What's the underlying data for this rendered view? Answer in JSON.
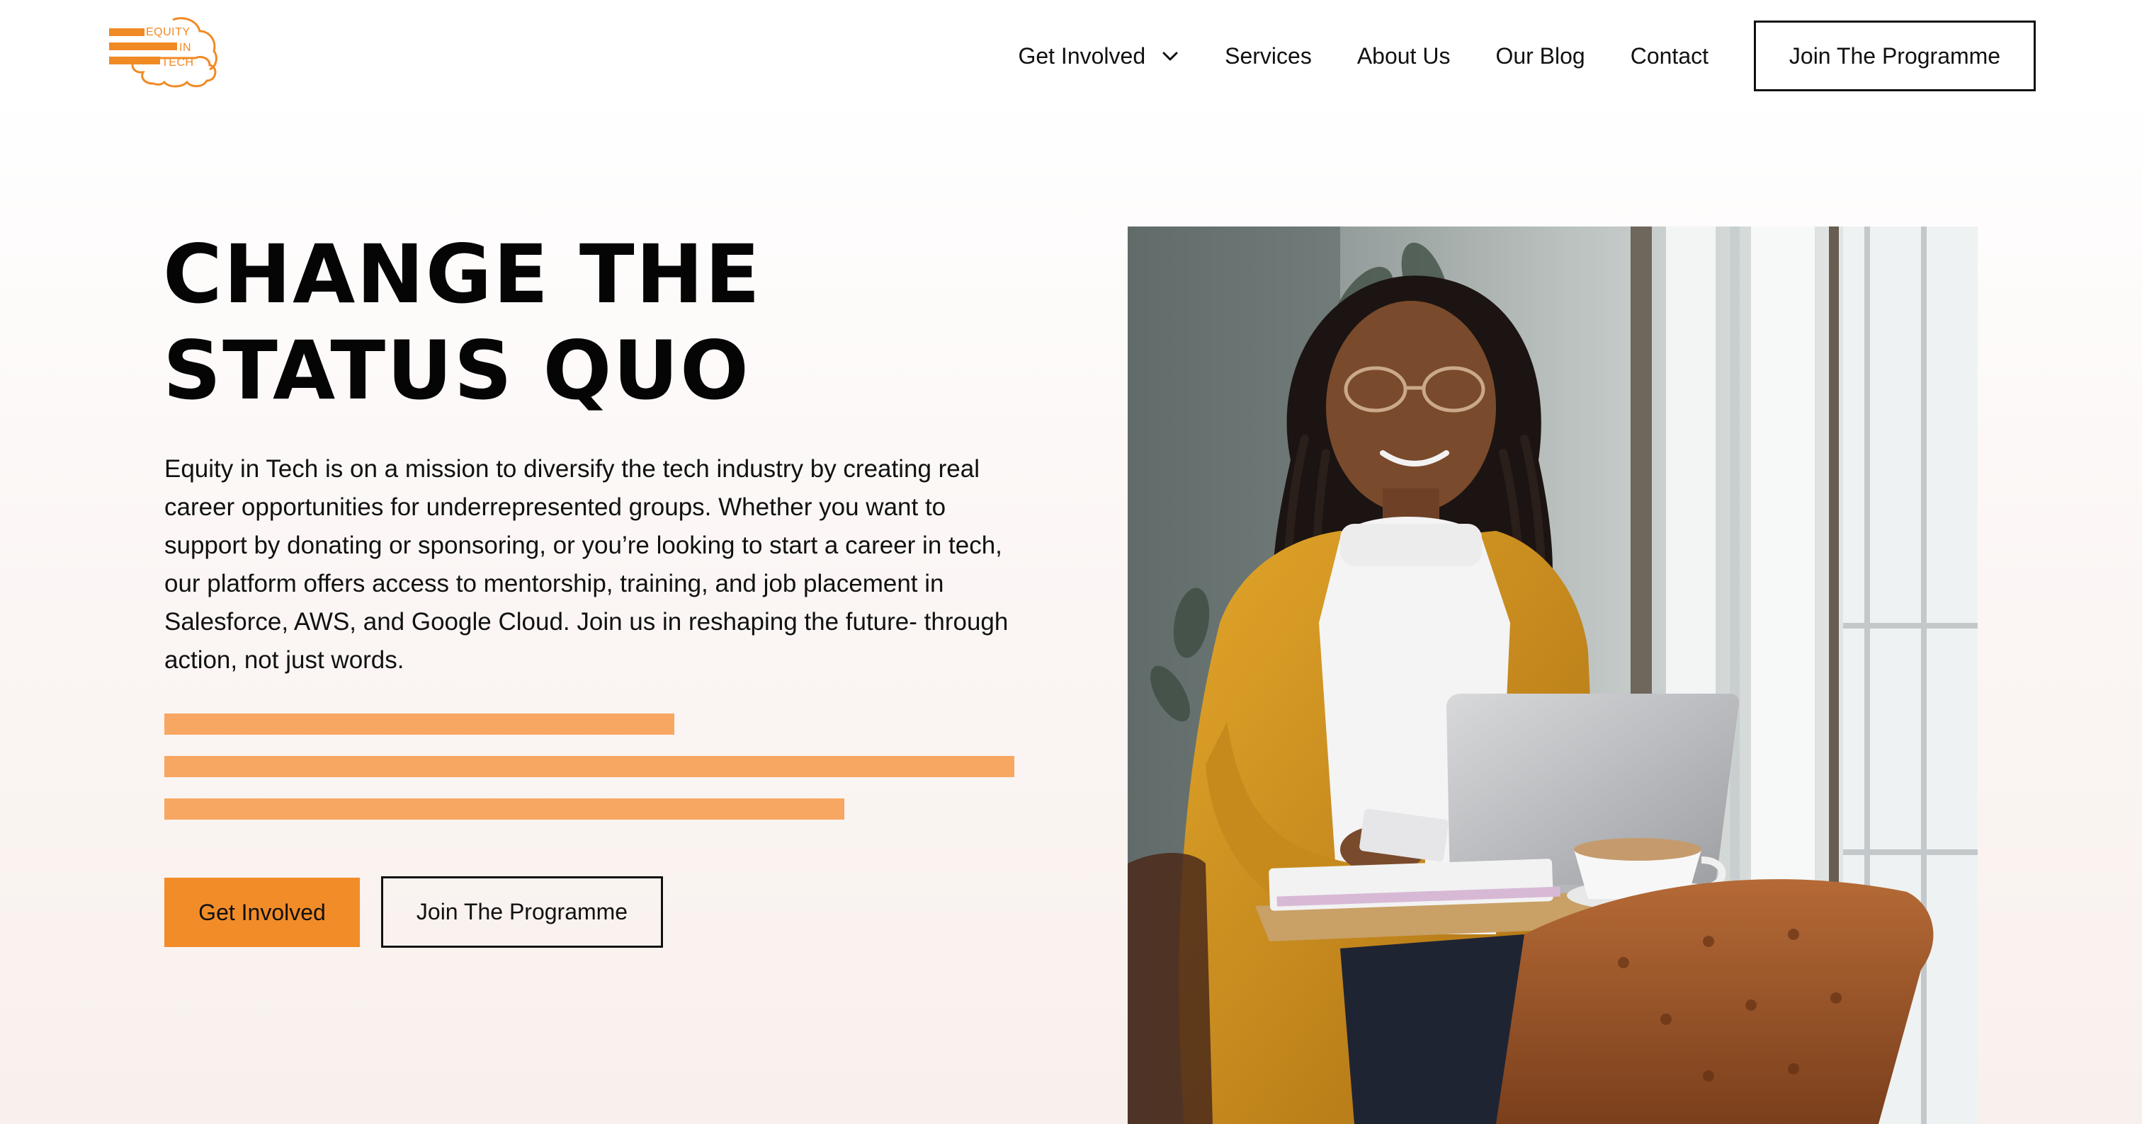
{
  "header": {
    "logo": {
      "line1": "EQUITY",
      "line2": "IN",
      "line3": "TECH",
      "color": "#f08a24"
    },
    "nav": {
      "get_involved": "Get Involved",
      "services": "Services",
      "about_us": "About Us",
      "our_blog": "Our Blog",
      "contact": "Contact",
      "join_button": "Join The Programme"
    }
  },
  "hero": {
    "title": "CHANGE THE STATUS QUO",
    "description": "Equity in Tech is on a mission to diversify the tech industry by creating real career opportunities for underrepresented groups. Whether you want to support by donating or sponsoring, or you’re looking to start a career in tech, our platform offers access to mentorship, training, and job placement in Salesforce, AWS, and Google Cloud. Join us in reshaping the future- through action, not just words.",
    "primary_button": "Get Involved",
    "secondary_button": "Join The Programme",
    "image_subject": "woman-using-laptop-in-cafe-photo"
  },
  "colors": {
    "accent": "#f28c28",
    "accent_light": "#f8a762",
    "text": "#111111"
  },
  "icons": {
    "dropdown": "chevron-down-icon"
  }
}
